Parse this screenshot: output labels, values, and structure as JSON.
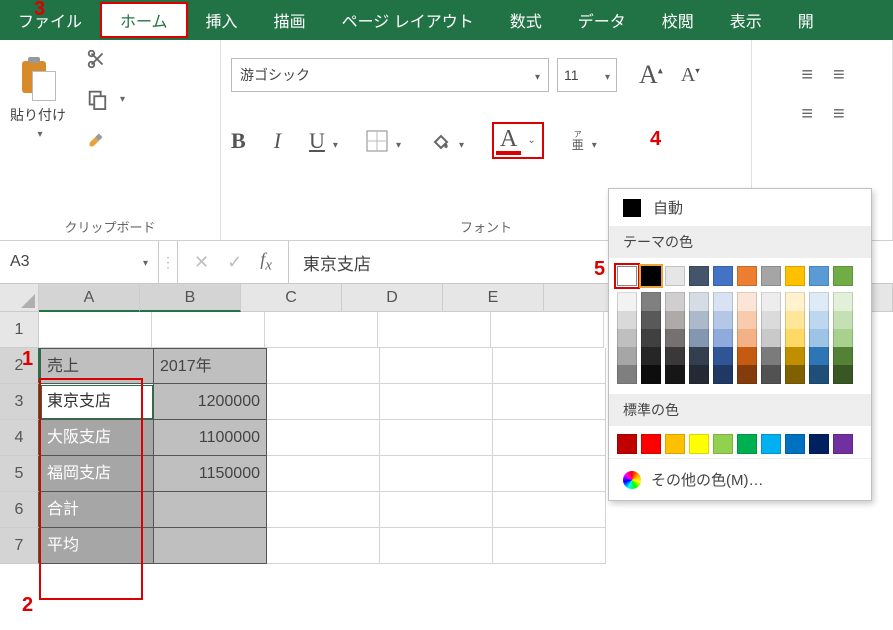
{
  "tabs": [
    "ファイル",
    "ホーム",
    "挿入",
    "描画",
    "ページ レイアウト",
    "数式",
    "データ",
    "校閲",
    "表示",
    "開"
  ],
  "activeTab": 1,
  "clipboard": {
    "paste": "貼り付け",
    "label": "クリップボード"
  },
  "font": {
    "name": "游ゴシック",
    "size": "11",
    "groupLabel": "フォント",
    "bold": "B",
    "italic": "I",
    "underline": "U"
  },
  "nameBox": "A3",
  "fxValue": "東京支店",
  "columns": [
    "A",
    "B",
    "C",
    "D",
    "E"
  ],
  "rows": [
    {
      "r": "1",
      "cells": [
        "",
        ""
      ]
    },
    {
      "r": "2",
      "cells": [
        "売上",
        "2017年"
      ]
    },
    {
      "r": "3",
      "cells": [
        "東京支店",
        "1200000"
      ]
    },
    {
      "r": "4",
      "cells": [
        "大阪支店",
        "1100000"
      ]
    },
    {
      "r": "5",
      "cells": [
        "福岡支店",
        "1150000"
      ]
    },
    {
      "r": "6",
      "cells": [
        "合計",
        ""
      ]
    },
    {
      "r": "7",
      "cells": [
        "平均",
        ""
      ]
    }
  ],
  "picker": {
    "auto": "自動",
    "themeHdr": "テーマの色",
    "stdHdr": "標準の色",
    "more": "その他の色(M)…",
    "theme": [
      "#ffffff",
      "#000000",
      "#e7e6e6",
      "#44546a",
      "#4472c4",
      "#ed7d31",
      "#a5a5a5",
      "#ffc000",
      "#5b9bd5",
      "#70ad47"
    ],
    "tints": [
      [
        "#f2f2f2",
        "#d9d9d9",
        "#bfbfbf",
        "#a6a6a6",
        "#7f7f7f"
      ],
      [
        "#808080",
        "#595959",
        "#404040",
        "#262626",
        "#0d0d0d"
      ],
      [
        "#d0cece",
        "#aeaaaa",
        "#757171",
        "#3a3838",
        "#161616"
      ],
      [
        "#d6dce5",
        "#acb9ca",
        "#8497b0",
        "#333f4f",
        "#222b35"
      ],
      [
        "#d9e2f3",
        "#b4c7e7",
        "#8faadc",
        "#2f5597",
        "#203864"
      ],
      [
        "#fbe5d6",
        "#f8cbad",
        "#f4b183",
        "#c55a11",
        "#843c0c"
      ],
      [
        "#ededed",
        "#dbdbdb",
        "#c9c9c9",
        "#7b7b7b",
        "#525252"
      ],
      [
        "#fff2cc",
        "#ffe699",
        "#ffd966",
        "#bf8f00",
        "#806000"
      ],
      [
        "#deebf7",
        "#bdd7ee",
        "#9dc3e6",
        "#2e75b6",
        "#1f4e79"
      ],
      [
        "#e2f0d9",
        "#c5e0b4",
        "#a9d18e",
        "#548235",
        "#385723"
      ]
    ],
    "standard": [
      "#c00000",
      "#ff0000",
      "#ffc000",
      "#ffff00",
      "#92d050",
      "#00b050",
      "#00b0f0",
      "#0070c0",
      "#002060",
      "#7030a0"
    ]
  },
  "ann": {
    "1": "1",
    "2": "2",
    "3": "3",
    "4": "4",
    "5": "5"
  }
}
